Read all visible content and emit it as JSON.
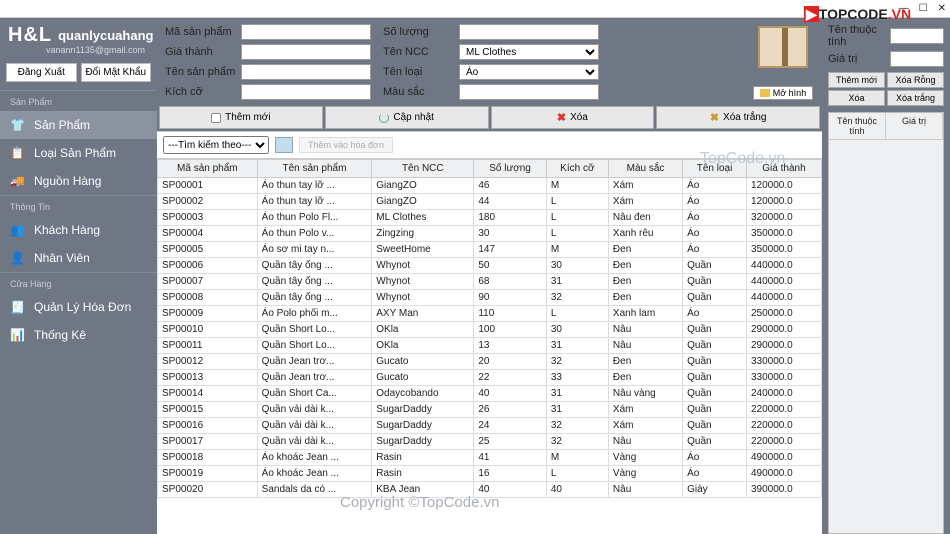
{
  "titlebar": {
    "min": "—",
    "max": "☐",
    "close": "✕"
  },
  "brand": {
    "logo": "H&L",
    "name": "quanlycuahang",
    "email": "vanann1135@gmail.com"
  },
  "top_buttons": {
    "logout": "Đăng Xuất",
    "change_pw": "Đổi Mật Khẩu"
  },
  "sections": {
    "products": {
      "header": "Sản Phẩm",
      "item1": "Sản Phẩm",
      "item2": "Loại Sản Phẩm",
      "item3": "Nguồn Hàng"
    },
    "info": {
      "header": "Thông Tin",
      "item1": "Khách Hàng",
      "item2": "Nhân Viên"
    },
    "store": {
      "header": "Cửa Hàng",
      "item1": "Quản Lý Hóa Đơn",
      "item2": "Thống Kê"
    }
  },
  "form": {
    "ma_sp": "Mã sản phẩm",
    "gia_thanh": "Giá thành",
    "ten_sp": "Tên sản phẩm",
    "kich_co": "Kích cỡ",
    "so_luong": "Số lượng",
    "ten_ncc": "Tên NCC",
    "ten_loai": "Tên loại",
    "mau_sac": "Màu sắc",
    "ncc_val": "ML Clothes",
    "loai_val": "Áo",
    "open": "Mở hình"
  },
  "right": {
    "thuoc_tinh": "Tên thuộc tính",
    "gia_tri": "Giá trị",
    "btn_add": "Thêm mới",
    "btn_empty": "Xóa Rỗng",
    "btn_del": "Xóa",
    "btn_clear": "Xóa trắng",
    "th1": "Tên thuộc tính",
    "th2": "Giá trị"
  },
  "actions": {
    "add": "Thêm mới",
    "update": "Cập nhật",
    "del": "Xóa",
    "clear": "Xóa trắng"
  },
  "search": {
    "placeholder": "---Tìm kiếm theo---",
    "add_invoice": "Thêm vào hóa đơn"
  },
  "columns": [
    "Mã sản phẩm",
    "Tên sản phẩm",
    "Tên NCC",
    "Số lượng",
    "Kích cỡ",
    "Màu sắc",
    "Tên loại",
    "Giá thành"
  ],
  "rows": [
    [
      "SP00001",
      "Áo thun tay lỡ ...",
      "GiangZO",
      "46",
      "M",
      "Xám",
      "Áo",
      "120000.0"
    ],
    [
      "SP00002",
      "Áo thun tay lỡ ...",
      "GiangZO",
      "44",
      "L",
      "Xám",
      "Áo",
      "120000.0"
    ],
    [
      "SP00003",
      "Áo thun Polo Fl...",
      "ML Clothes",
      "180",
      "L",
      "Nâu đen",
      "Áo",
      "320000.0"
    ],
    [
      "SP00004",
      "Áo thun Polo v...",
      "Zingzing",
      "30",
      "L",
      "Xanh rêu",
      "Áo",
      "350000.0"
    ],
    [
      "SP00005",
      "Áo sơ mi tay n...",
      "SweetHome",
      "147",
      "M",
      "Đen",
      "Áo",
      "350000.0"
    ],
    [
      "SP00006",
      "Quần tây ống ...",
      "Whynot",
      "50",
      "30",
      "Đen",
      "Quần",
      "440000.0"
    ],
    [
      "SP00007",
      "Quần tây ống ...",
      "Whynot",
      "68",
      "31",
      "Đen",
      "Quần",
      "440000.0"
    ],
    [
      "SP00008",
      "Quần tây ống ...",
      "Whynot",
      "90",
      "32",
      "Đen",
      "Quần",
      "440000.0"
    ],
    [
      "SP00009",
      "Áo Polo phối m...",
      "AXY Man",
      "110",
      "L",
      "Xanh lam",
      "Áo",
      "250000.0"
    ],
    [
      "SP00010",
      "Quần Short Lo...",
      "OKla",
      "100",
      "30",
      "Nâu",
      "Quần",
      "290000.0"
    ],
    [
      "SP00011",
      "Quần Short Lo...",
      "OKla",
      "13",
      "31",
      "Nâu",
      "Quần",
      "290000.0"
    ],
    [
      "SP00012",
      "Quần Jean trơ...",
      "Gucato",
      "20",
      "32",
      "Đen",
      "Quần",
      "330000.0"
    ],
    [
      "SP00013",
      "Quần Jean trơ...",
      "Gucato",
      "22",
      "33",
      "Đen",
      "Quần",
      "330000.0"
    ],
    [
      "SP00014",
      "Quần Short Ca...",
      "Odaycobando",
      "40",
      "31",
      "Nâu vàng",
      "Quần",
      "240000.0"
    ],
    [
      "SP00015",
      "Quần vải dài k...",
      "SugarDaddy",
      "26",
      "31",
      "Xám",
      "Quần",
      "220000.0"
    ],
    [
      "SP00016",
      "Quần vải dài k...",
      "SugarDaddy",
      "24",
      "32",
      "Xám",
      "Quần",
      "220000.0"
    ],
    [
      "SP00017",
      "Quần vải dài k...",
      "SugarDaddy",
      "25",
      "32",
      "Nâu",
      "Quần",
      "220000.0"
    ],
    [
      "SP00018",
      "Áo khoác Jean ...",
      "Rasin",
      "41",
      "M",
      "Vàng",
      "Áo",
      "490000.0"
    ],
    [
      "SP00019",
      "Áo khoác Jean ...",
      "Rasin",
      "16",
      "L",
      "Vàng",
      "Áo",
      "490000.0"
    ],
    [
      "SP00020",
      "Sandals da có ...",
      "KBA Jean",
      "40",
      "40",
      "Nâu",
      "Giày",
      "390000.0"
    ]
  ],
  "watermark": {
    "w1": "TopCode.vn",
    "w2": "Copyright ©TopCode.vn",
    "w3a": "▶",
    "w3b": "TOPCODE",
    "w3c": ".VN"
  }
}
